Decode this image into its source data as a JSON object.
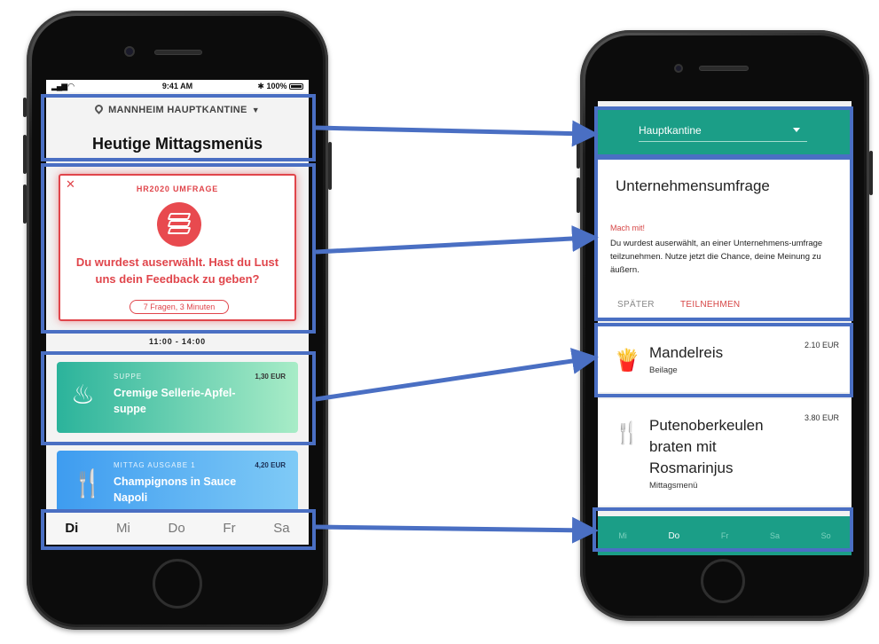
{
  "left_app": {
    "status_bar": {
      "time": "9:41 AM",
      "battery": "100%"
    },
    "location": "MANNHEIM HAUPTKANTINE",
    "title": "Heutige Mittagsmenüs",
    "survey": {
      "heading": "HR2020 UMFRAGE",
      "question": "Du wurdest auserwählt. Hast du Lust uns dein Feedback zu geben?",
      "badge": "7 Fragen, 3 Minuten"
    },
    "serving_time": "11:00 - 14:00",
    "meals": [
      {
        "category": "SUPPE",
        "name": "Cremige Sellerie-Apfel-suppe",
        "price": "1,30 EUR"
      },
      {
        "category": "MITTAG AUSGABE 1",
        "name": "Champignons in Sauce Napoli",
        "price": "4,20 EUR"
      }
    ],
    "days": [
      "Di",
      "Mi",
      "Do",
      "Fr",
      "Sa"
    ],
    "active_day": "Di"
  },
  "right_app": {
    "location": "Hauptkantine",
    "survey": {
      "title": "Unternehmensumfrage",
      "tag": "Mach mit!",
      "text": "Du wurdest auserwählt, an einer Unternehmens-umfrage teilzunehmen. Nutze jetzt die Chance, deine Meinung zu äußern.",
      "later": "SPÄTER",
      "join": "TEILNEHMEN"
    },
    "meals": [
      {
        "name": "Mandelreis",
        "category": "Beilage",
        "price": "2.10 EUR"
      },
      {
        "name": "Putenoberkeulen braten mit Rosmarinjus",
        "category": "Mittagsmenü",
        "price": "3.80 EUR"
      }
    ],
    "days": [
      "Mi",
      "Do",
      "Fr",
      "Sa",
      "So"
    ],
    "active_day": "Do"
  },
  "colors": {
    "survey_red": "#e0454b",
    "annotation_blue": "#4a6fc3",
    "teal": "#1b9e87"
  }
}
